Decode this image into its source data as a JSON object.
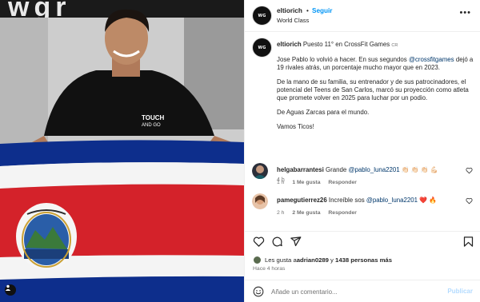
{
  "colors": {
    "link_blue": "#0095f6",
    "mention_blue": "#00376b",
    "secondary_text": "#737373",
    "heart_red": "#ed4956",
    "flag_blue": "#0d2e8c",
    "flag_red": "#d4222a"
  },
  "photo": {
    "background_letters": "wgr",
    "shirt_text_line1": "TOUCH",
    "shirt_text_line2": "AND GO",
    "user_tag_icon": "person-icon"
  },
  "header": {
    "username": "eltiorich",
    "separator": "•",
    "follow_label": "Seguir",
    "location": "World Class",
    "more_icon": "more-horizontal-icon",
    "avatar_logo": "WG"
  },
  "caption": {
    "username": "eltiorich",
    "lead": "Puesto 11° en CrossFit Games",
    "flag_code": "CR",
    "para1_a": "Jose Pablo lo volvió a hacer. En sus segundos ",
    "para1_mention": "@crossfitgames",
    "para1_b": " dejó a 19 rivales atrás, un porcentaje mucho mayor que en 2023.",
    "para2": "De la mano de su familia, su entrenador y de sus patrocinadores, el potencial del Teens de San Carlos, marcó su proyección como atleta que promete volver en 2025 para luchar por un podio.",
    "para3": "De Aguas Zarcas para el mundo.",
    "para4": "Vamos Ticos!",
    "time": "4 h"
  },
  "comments": [
    {
      "username": "helgabarrantesi",
      "text_before": "Grande ",
      "mention": "@pablo_luna2201",
      "emojis": "👏🏻 👏🏻 👏🏻 💪🏻",
      "time": "1 h",
      "likes": "1 Me gusta",
      "reply": "Responder"
    },
    {
      "username": "pamegutierrez26",
      "text_before": "Increíble sos ",
      "mention": "@pablo_luna2201",
      "emojis": "❤️ 🔥",
      "time": "2 h",
      "likes": "2 Me gusta",
      "reply": "Responder"
    }
  ],
  "actions": {
    "like_icon": "heart-icon",
    "comment_icon": "comment-icon",
    "share_icon": "share-icon",
    "save_icon": "bookmark-icon"
  },
  "likes": {
    "prefix": "Les gusta a ",
    "user": "adrian0289",
    "middle": " y ",
    "count": "1438 personas más"
  },
  "posted_time": "Hace 4 horas",
  "comment_box": {
    "emoji_icon": "emoji-icon",
    "placeholder": "Añade un comentario...",
    "publish_label": "Publicar"
  }
}
